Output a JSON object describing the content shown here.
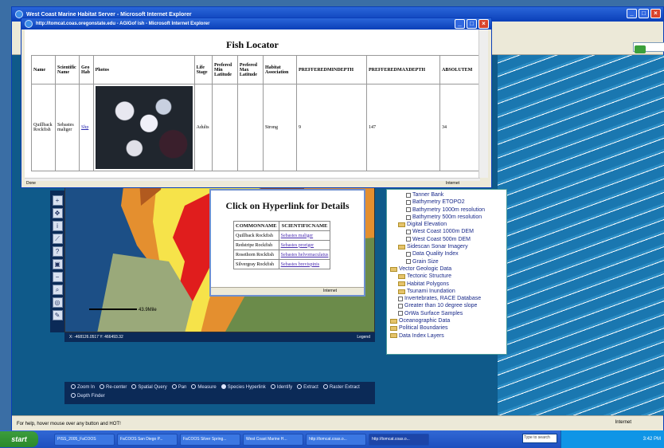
{
  "main_window": {
    "title": "West Coast Marine Habitat Server - Microsoft Internet Explorer",
    "status": "For help, hover mouse over any button and HOT!",
    "zone": "Internet"
  },
  "fish_window": {
    "title": "http://tomcat.coas.oregonstate.edu - AGIGof ish - Microsoft Internet Explorer",
    "heading": "Fish Locator",
    "status_left": "Done",
    "status_right": "Internet",
    "columns": [
      "Name",
      "Scientific Name",
      "Geo Hab",
      "Photos",
      "Life Stage",
      "Prefered Min Latitude",
      "Prefered Max Latitude",
      "Habitat Association",
      "PREFFEREDMINDEPTH",
      "PREFFEREDMAXDEPTH",
      "ABSOLUTEM"
    ],
    "row": {
      "name": "Quillback Rockfish",
      "scientific": "Sebastes maliger",
      "geohab": "Shp",
      "life_stage": "Adults",
      "min_lat": "",
      "max_lat": "",
      "habitat": "Strong",
      "min_depth": "9",
      "max_depth": "147",
      "abs": "34"
    }
  },
  "hyperlink_popup": {
    "heading": "Click on Hyperlink for Details",
    "header": [
      "COMMONNAME",
      "SCIENTIFICNAME"
    ],
    "rows": [
      {
        "common": "Quillback Rockfish",
        "scientific": "Sebastes maliger"
      },
      {
        "common": "Redstripe Rockfish",
        "scientific": "Sebastes proriger"
      },
      {
        "common": "Rosethorn Rockfish",
        "scientific": "Sebastes helvomaculatus"
      },
      {
        "common": "Silvergray Rockfish",
        "scientific": "Sebastes brevispinis"
      }
    ],
    "status": "Internet"
  },
  "layers": [
    {
      "label": "Tanner Bank",
      "level": 2,
      "type": "box"
    },
    {
      "label": "Bathymetry ETOPO2",
      "level": 2,
      "type": "box"
    },
    {
      "label": "Bathymetry 1000m resolution",
      "level": 2,
      "type": "box"
    },
    {
      "label": "Bathymetry 500m resolution",
      "level": 2,
      "type": "box"
    },
    {
      "label": "Digital Elevation",
      "level": 1,
      "type": "fold"
    },
    {
      "label": "West Coast 1000m DEM",
      "level": 2,
      "type": "box"
    },
    {
      "label": "West Coast 500m DEM",
      "level": 2,
      "type": "box"
    },
    {
      "label": "Sidescan Sonar Imagery",
      "level": 1,
      "type": "fold"
    },
    {
      "label": "Data Quality Index",
      "level": 2,
      "type": "box"
    },
    {
      "label": "Grain Size",
      "level": 2,
      "type": "box"
    },
    {
      "label": "Vector Geologic Data",
      "level": 0,
      "type": "fold"
    },
    {
      "label": "Tectonic Structure",
      "level": 1,
      "type": "fold"
    },
    {
      "label": "Habitat Polygons",
      "level": 1,
      "type": "fold"
    },
    {
      "label": "Tsunami Inundation",
      "level": 1,
      "type": "fold"
    },
    {
      "label": "Invertebrates, RACE Database",
      "level": 1,
      "type": "box"
    },
    {
      "label": "Greater than 10 degree slope",
      "level": 1,
      "type": "box"
    },
    {
      "label": "OrWa Surface Samples",
      "level": 1,
      "type": "box"
    },
    {
      "label": "Oceanographic Data",
      "level": 0,
      "type": "fold"
    },
    {
      "label": "Political Boundaries",
      "level": 0,
      "type": "fold"
    },
    {
      "label": "Data Index Layers",
      "level": 0,
      "type": "fold"
    }
  ],
  "map": {
    "scale_label": "43.9Mile",
    "coords": "X: -468126.0517  Y: 466493.32",
    "legend_label": "Legend",
    "tools": [
      {
        "label": "Zoom In",
        "on": false
      },
      {
        "label": "Re-center",
        "on": false
      },
      {
        "label": "Spatial Query",
        "on": false
      },
      {
        "label": "Pan",
        "on": false
      },
      {
        "label": "Measure",
        "on": false
      },
      {
        "label": "Species Hyperlink",
        "on": true
      },
      {
        "label": "Identify",
        "on": false
      },
      {
        "label": "Extract",
        "on": false
      },
      {
        "label": "Raster Extract",
        "on": false
      },
      {
        "label": "Depth Finder",
        "on": false
      }
    ]
  },
  "taskbar": {
    "start": "start",
    "tasks": [
      "PISS_2005_FaCOOS",
      "FaCOOS San Diego P...",
      "FaCOOS Silver Spring...",
      "West Coast Marine H...",
      "http://tomcat.coas.o...",
      "http://tomcat.coas.o..."
    ],
    "search": "Type to search",
    "clock": "3:42 PM"
  }
}
